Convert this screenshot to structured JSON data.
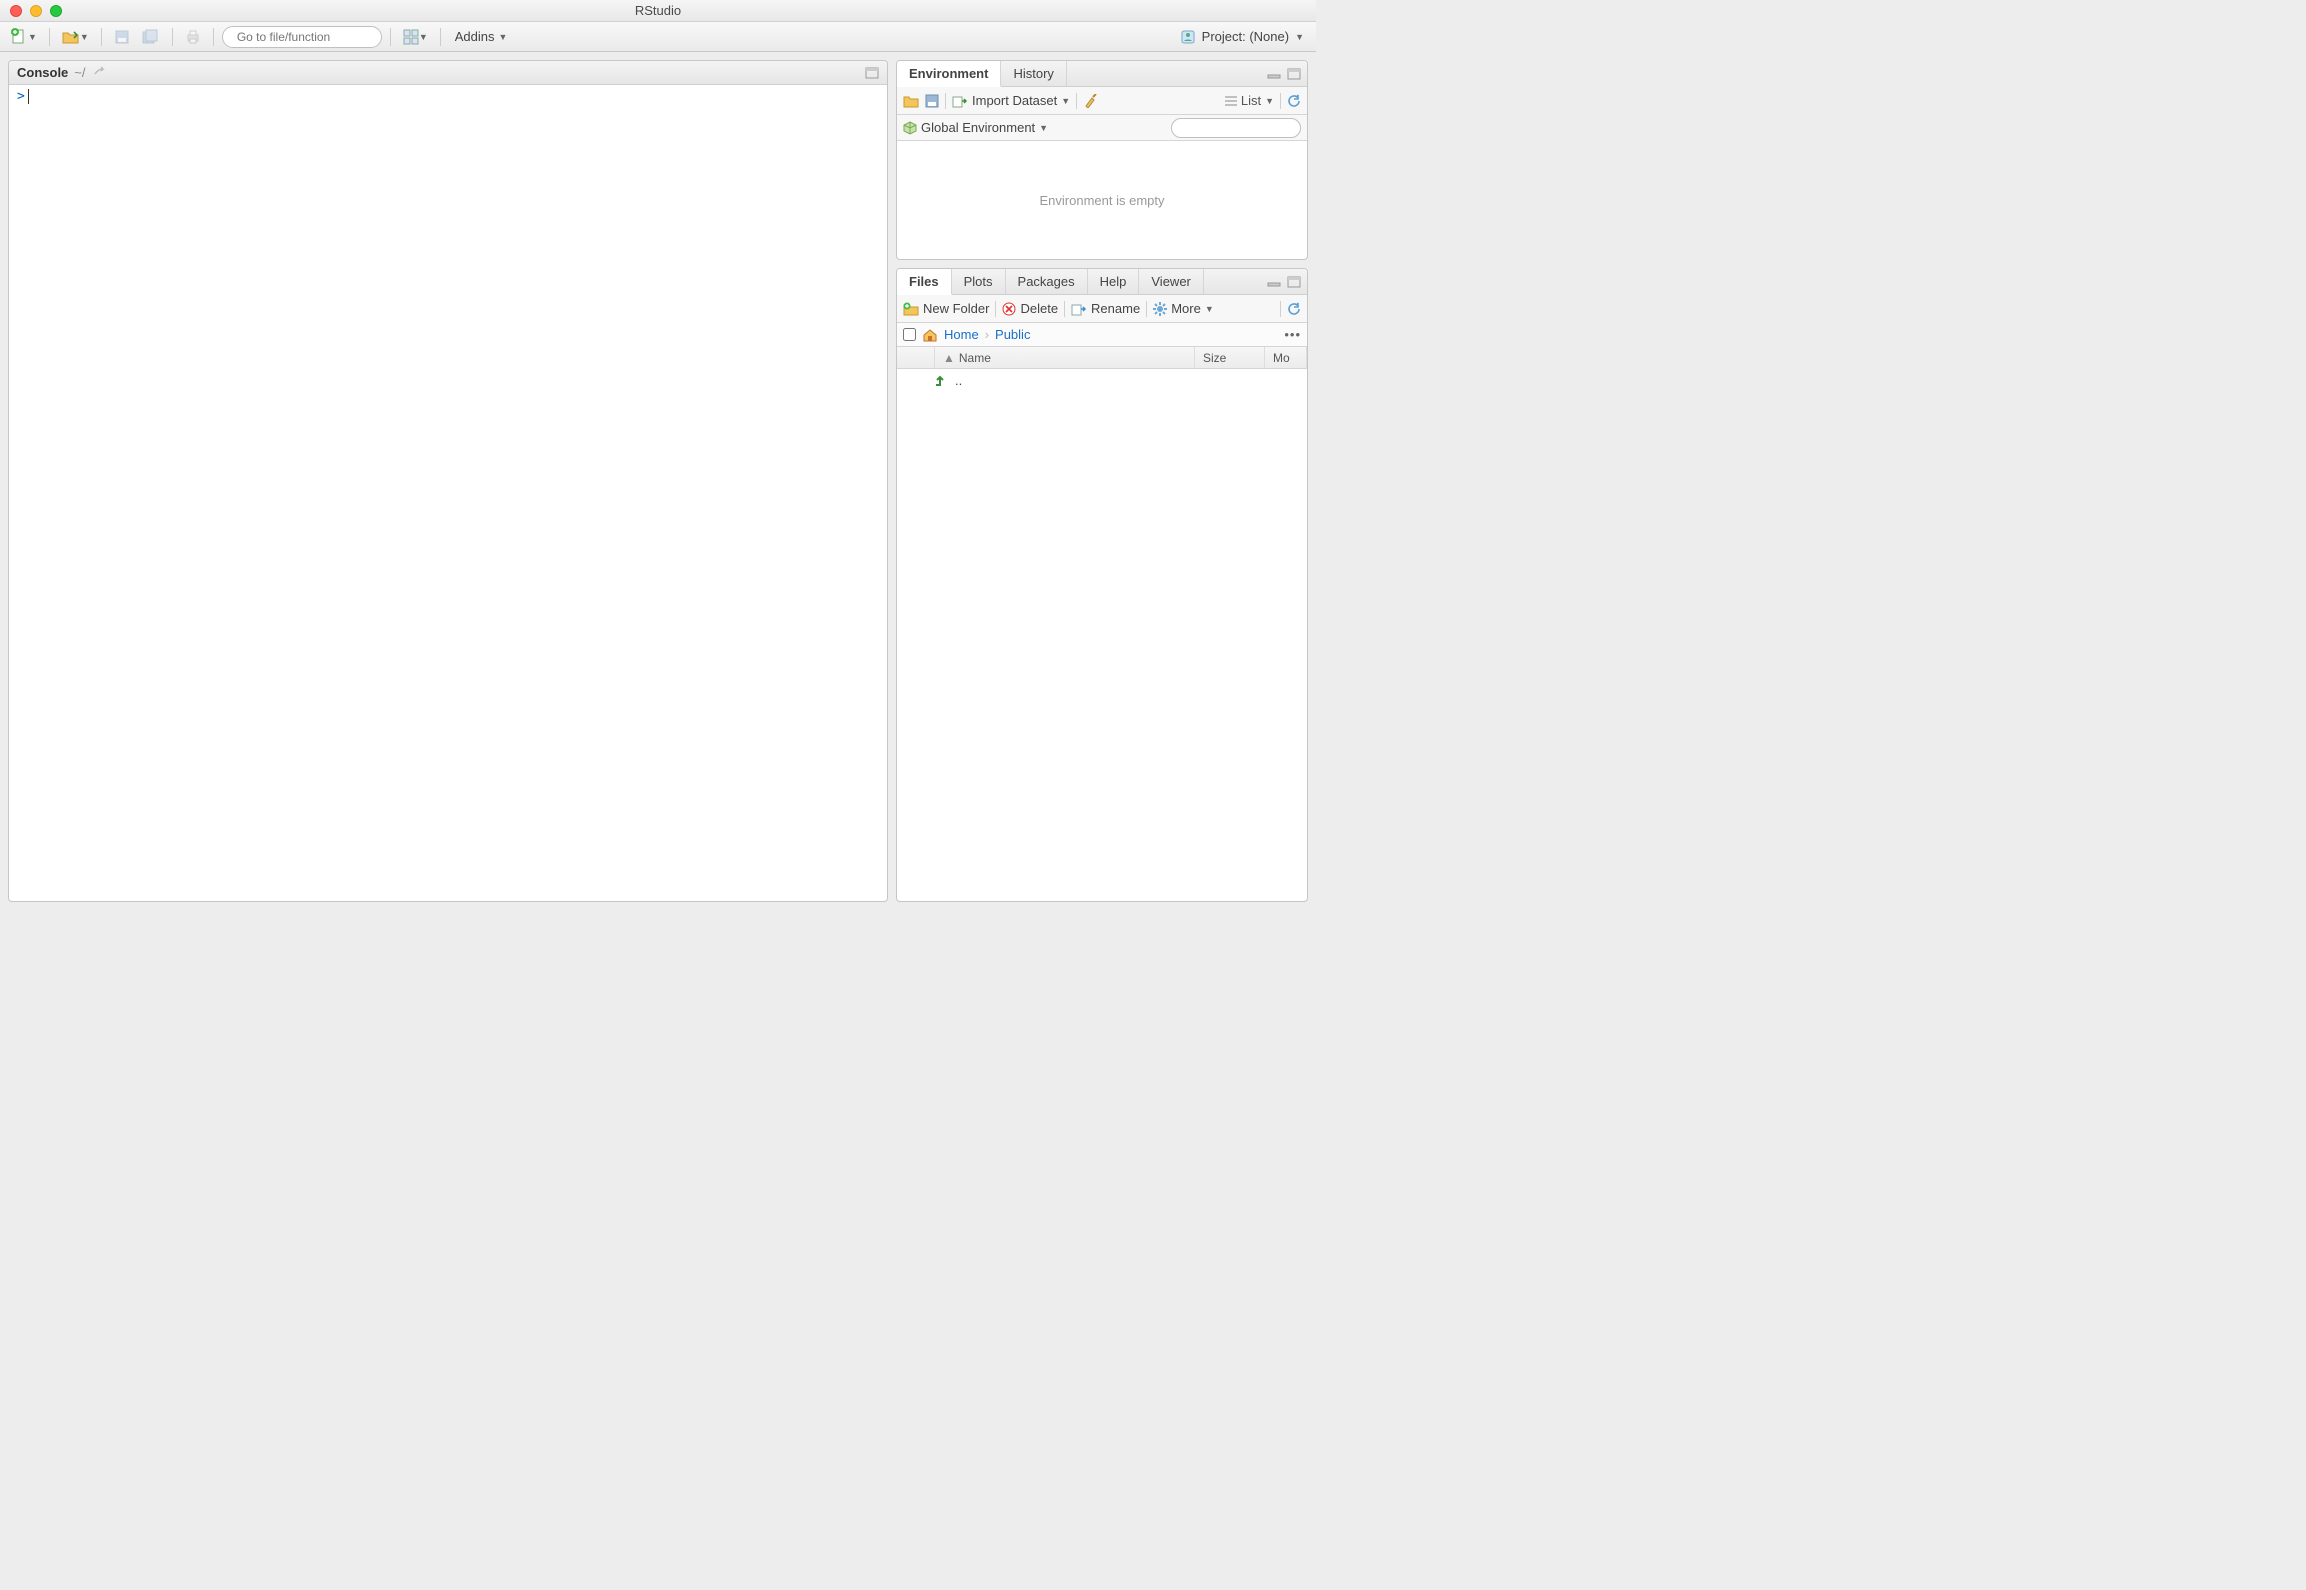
{
  "window": {
    "title": "RStudio"
  },
  "toolbar": {
    "search_placeholder": "Go to file/function",
    "addins_label": "Addins",
    "project_label": "Project: (None)"
  },
  "console": {
    "title": "Console",
    "path": "~/",
    "prompt": ">"
  },
  "env_pane": {
    "tabs": [
      "Environment",
      "History"
    ],
    "active_tab": 0,
    "import_label": "Import Dataset",
    "list_label": "List",
    "scope_label": "Global Environment",
    "search_placeholder": "",
    "empty_message": "Environment is empty"
  },
  "files_pane": {
    "tabs": [
      "Files",
      "Plots",
      "Packages",
      "Help",
      "Viewer"
    ],
    "active_tab": 0,
    "new_folder_label": "New Folder",
    "delete_label": "Delete",
    "rename_label": "Rename",
    "more_label": "More",
    "breadcrumbs": [
      "Home",
      "Public"
    ],
    "columns": {
      "name": "Name",
      "size": "Size",
      "modified": "Mo"
    },
    "parent_label": ".."
  }
}
